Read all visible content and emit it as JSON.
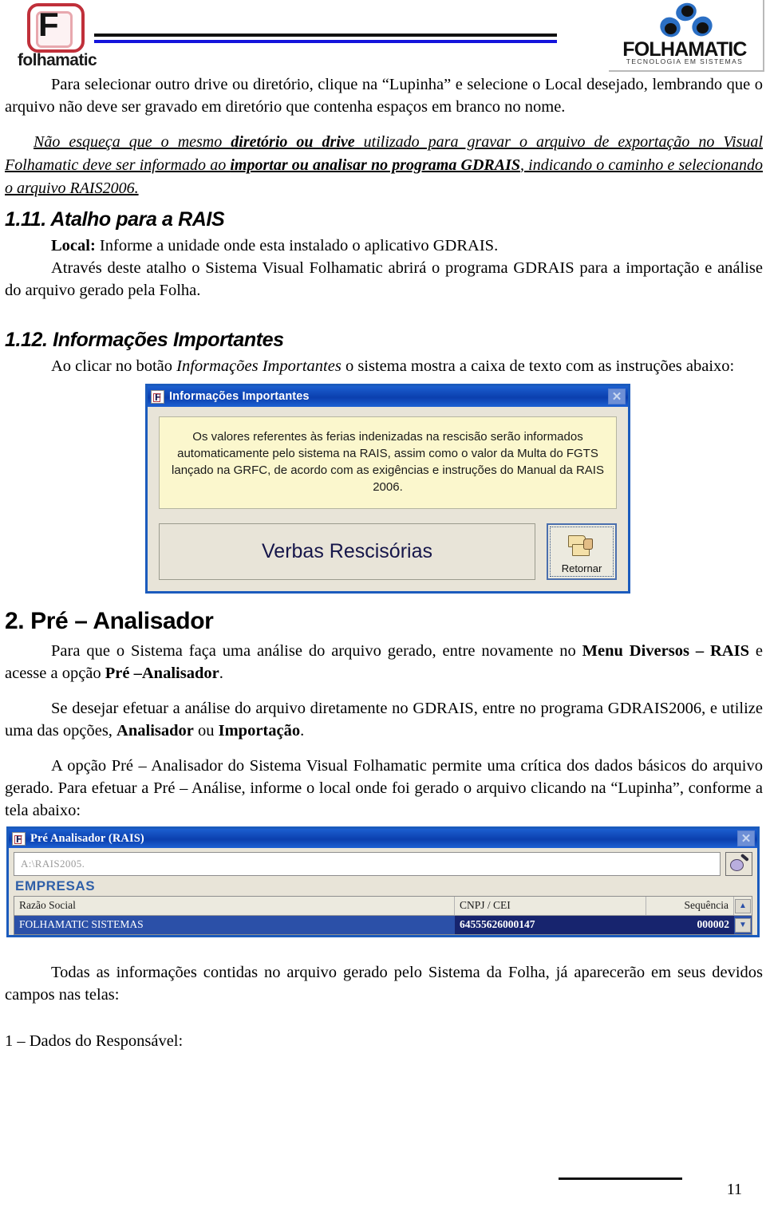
{
  "header": {
    "left_logo_letter": "F",
    "left_logo_word": "folhamatic",
    "right_logo_name": "FOLHAMATIC",
    "right_logo_tagline": "TECNOLOGIA EM SISTEMAS"
  },
  "content": {
    "para_1": "Para selecionar outro drive ou diretório, clique na “Lupinha” e selecione o Local desejado, lembrando que o arquivo não deve ser gravado em diretório que contenha espaços em branco no nome.",
    "note_intro": "Não esqueça que o mesmo ",
    "note_bold_1": "diretório ou drive",
    "note_mid_1": " utilizado para gravar o arquivo de exportação no Visual Folhamatic deve ser informado ao ",
    "note_bold_2": "importar ou analisar no programa GDRAIS",
    "note_end": ", indicando o caminho e selecionando o arquivo RAIS2006.",
    "section_111_title": "1.11. Atalho para a RAIS",
    "section_111_local_label": "Local:",
    "section_111_local_text": " Informe a unidade onde esta instalado o aplicativo GDRAIS.",
    "section_111_para": "Através deste atalho o Sistema Visual Folhamatic abrirá o programa GDRAIS para a importação e análise do arquivo gerado pela Folha.",
    "section_112_title": "1.12. Informações Importantes",
    "section_112_para_a": "Ao clicar no botão ",
    "section_112_para_italic": "Informações Importantes",
    "section_112_para_b": " o sistema mostra a caixa de texto com as instruções abaixo:",
    "section_2_title": "2. Pré – Analisador",
    "section_2_para1_a": "Para que o Sistema faça uma análise do arquivo gerado, entre novamente no ",
    "section_2_para1_bold1": "Menu Diversos – RAIS",
    "section_2_para1_b": " e acesse a opção ",
    "section_2_para1_bold2": "Pré –Analisador",
    "section_2_para1_c": ".",
    "section_2_para2_a": "Se desejar efetuar a análise do arquivo diretamente no GDRAIS, entre no programa GDRAIS2006, e utilize uma das opções, ",
    "section_2_para2_bold1": "Analisador",
    "section_2_para2_b": " ou ",
    "section_2_para2_bold2": "Importação",
    "section_2_para2_c": ".",
    "section_2_para3": "A opção Pré – Analisador do Sistema Visual Folhamatic permite uma  crítica dos dados básicos do arquivo gerado. Para efetuar a Pré – Análise, informe o local onde foi gerado o arquivo clicando na “Lupinha”, conforme a tela abaixo:",
    "closing_para": "Todas as informações contidas no arquivo gerado pelo Sistema da Folha, já aparecerão em seus devidos campos nas telas:",
    "closing_item": "1 – Dados do Responsável:"
  },
  "dialog_info": {
    "title": "Informações Importantes",
    "icon": "folhamatic-f-icon",
    "close_label": "✕",
    "message": "Os valores referentes às ferias indenizadas na rescisão serão informados automaticamente pelo sistema na RAIS, assim como o valor da Multa do FGTS lançado na GRFC, de acordo com as exigências e instruções do Manual da RAIS 2006.",
    "verbas_button": "Verbas Rescisórias",
    "retornar_button": "Retornar",
    "retornar_icon": "folder-return-icon"
  },
  "dialog_rais": {
    "title": "Pré Analisador (RAIS)",
    "icon": "folhamatic-f-icon",
    "close_label": "✕",
    "path_value": "A:\\RAIS2005.",
    "lupa_icon": "magnifier-icon",
    "group_label": "EMPRESAS",
    "columns": [
      "Razão Social",
      "CNPJ / CEI",
      "Sequência"
    ],
    "rows": [
      {
        "razao": "FOLHAMATIC SISTEMAS",
        "cnpj": "64555626000147",
        "seq": "000002"
      }
    ],
    "scroll_up": "▲",
    "scroll_down": "▼"
  },
  "footer": {
    "page_number": "11"
  },
  "colors": {
    "title_bar_blue": "#0b3fae",
    "window_border": "#1b5bbd",
    "message_yellow": "#fbf7cd",
    "grid_selection": "#2b50a8",
    "grid_selection_dark": "#17246e",
    "empresas_label": "#2f5fa8",
    "rule_blue": "#1414dc",
    "logo_red": "#c0303a"
  }
}
